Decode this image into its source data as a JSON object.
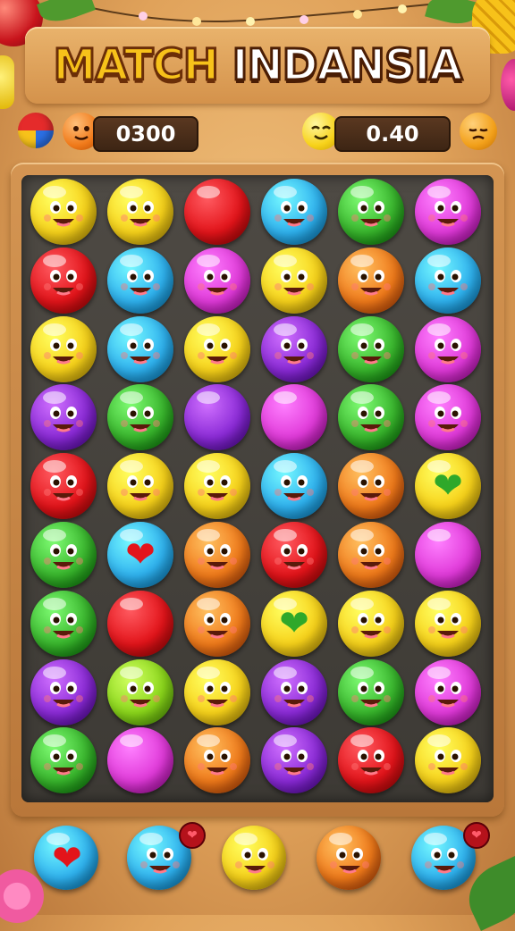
{
  "title": {
    "part1": "MATCH",
    "part2": "INDANSIA"
  },
  "hud": {
    "score_left": "0300",
    "score_right": "0.40"
  },
  "colors": {
    "yellow": "#f7d21a",
    "blue": "#2fb2ef",
    "red": "#e3141a",
    "green": "#38b52c",
    "magenta": "#e03ad9",
    "orange": "#f07a1a",
    "purple": "#8a2ad6",
    "lime": "#8ad61a"
  },
  "grid": {
    "rows": [
      [
        {
          "c": "yellow",
          "f": "face"
        },
        {
          "c": "yellow",
          "f": "face"
        },
        {
          "c": "red",
          "f": "none"
        },
        {
          "c": "blue",
          "f": "face"
        },
        {
          "c": "green",
          "f": "face"
        },
        {
          "c": "magenta",
          "f": "face"
        }
      ],
      [
        {
          "c": "red",
          "f": "face"
        },
        {
          "c": "blue",
          "f": "face"
        },
        {
          "c": "magenta",
          "f": "face"
        },
        {
          "c": "yellow",
          "f": "face"
        },
        {
          "c": "orange",
          "f": "face"
        },
        {
          "c": "blue",
          "f": "face"
        }
      ],
      [
        {
          "c": "yellow",
          "f": "face"
        },
        {
          "c": "blue",
          "f": "face"
        },
        {
          "c": "yellow",
          "f": "face"
        },
        {
          "c": "purple",
          "f": "face"
        },
        {
          "c": "green",
          "f": "face"
        },
        {
          "c": "magenta",
          "f": "face"
        }
      ],
      [
        {
          "c": "purple",
          "f": "face"
        },
        {
          "c": "green",
          "f": "face"
        },
        {
          "c": "purple",
          "f": "none"
        },
        {
          "c": "magenta",
          "f": "none"
        },
        {
          "c": "green",
          "f": "face"
        },
        {
          "c": "magenta",
          "f": "face"
        }
      ],
      [
        {
          "c": "red",
          "f": "face"
        },
        {
          "c": "yellow",
          "f": "face"
        },
        {
          "c": "yellow",
          "f": "face"
        },
        {
          "c": "blue",
          "f": "face"
        },
        {
          "c": "orange",
          "f": "face"
        },
        {
          "c": "yellow",
          "f": "heart-green"
        }
      ],
      [
        {
          "c": "green",
          "f": "face"
        },
        {
          "c": "blue",
          "f": "heart-red"
        },
        {
          "c": "orange",
          "f": "face"
        },
        {
          "c": "red",
          "f": "face"
        },
        {
          "c": "orange",
          "f": "face"
        },
        {
          "c": "magenta",
          "f": "none"
        }
      ],
      [
        {
          "c": "green",
          "f": "face"
        },
        {
          "c": "red",
          "f": "none"
        },
        {
          "c": "orange",
          "f": "face"
        },
        {
          "c": "yellow",
          "f": "heart-green"
        },
        {
          "c": "yellow",
          "f": "face"
        },
        {
          "c": "yellow",
          "f": "face"
        }
      ],
      [
        {
          "c": "purple",
          "f": "face"
        },
        {
          "c": "lime",
          "f": "face"
        },
        {
          "c": "yellow",
          "f": "face"
        },
        {
          "c": "purple",
          "f": "face"
        },
        {
          "c": "green",
          "f": "face"
        },
        {
          "c": "magenta",
          "f": "face"
        }
      ],
      [
        {
          "c": "green",
          "f": "face"
        },
        {
          "c": "magenta",
          "f": "none"
        },
        {
          "c": "orange",
          "f": "face"
        },
        {
          "c": "purple",
          "f": "face"
        },
        {
          "c": "red",
          "f": "face"
        },
        {
          "c": "yellow",
          "f": "face"
        }
      ]
    ]
  },
  "tray": [
    {
      "c": "blue",
      "f": "heart-red",
      "badge": false
    },
    {
      "c": "blue",
      "f": "face",
      "badge": true
    },
    {
      "c": "yellow",
      "f": "face",
      "badge": false
    },
    {
      "c": "orange",
      "f": "face",
      "badge": false
    },
    {
      "c": "blue",
      "f": "face",
      "badge": true
    }
  ]
}
